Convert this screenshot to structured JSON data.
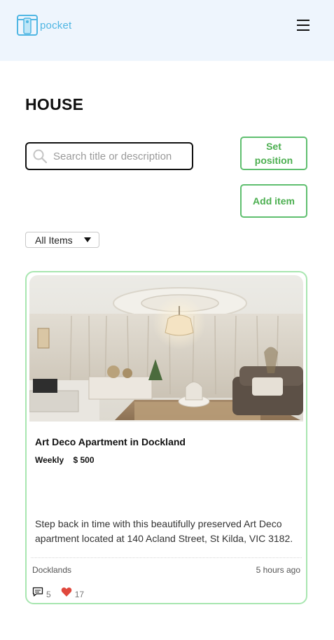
{
  "header": {
    "brand": "pocket",
    "logo_icon": "pocket-logo-icon",
    "menu_icon": "hamburger-menu-icon"
  },
  "page": {
    "title": "HOUSE"
  },
  "search": {
    "placeholder": "Search title or description",
    "value": "",
    "icon": "search-icon"
  },
  "actions": {
    "set_position_label": "Set position",
    "add_item_label": "Add item"
  },
  "filter": {
    "selected": "All Items"
  },
  "listing": {
    "title": "Art Deco Apartment in Dockland",
    "price_period": "Weekly",
    "price": "$ 500",
    "description": "Step back in time with this beautifully preserved Art Deco apartment located at 140 Acland Street, St Kilda, VIC 3182.",
    "location": "Docklands",
    "posted": "5 hours ago",
    "comments": "5",
    "likes": "17",
    "image": "living-room-photo"
  },
  "colors": {
    "header_bg": "#eef5fd",
    "brand": "#4fb6e3",
    "accent_green": "#4caf50",
    "card_border": "#a8e6b0",
    "heart": "#e0483d"
  }
}
